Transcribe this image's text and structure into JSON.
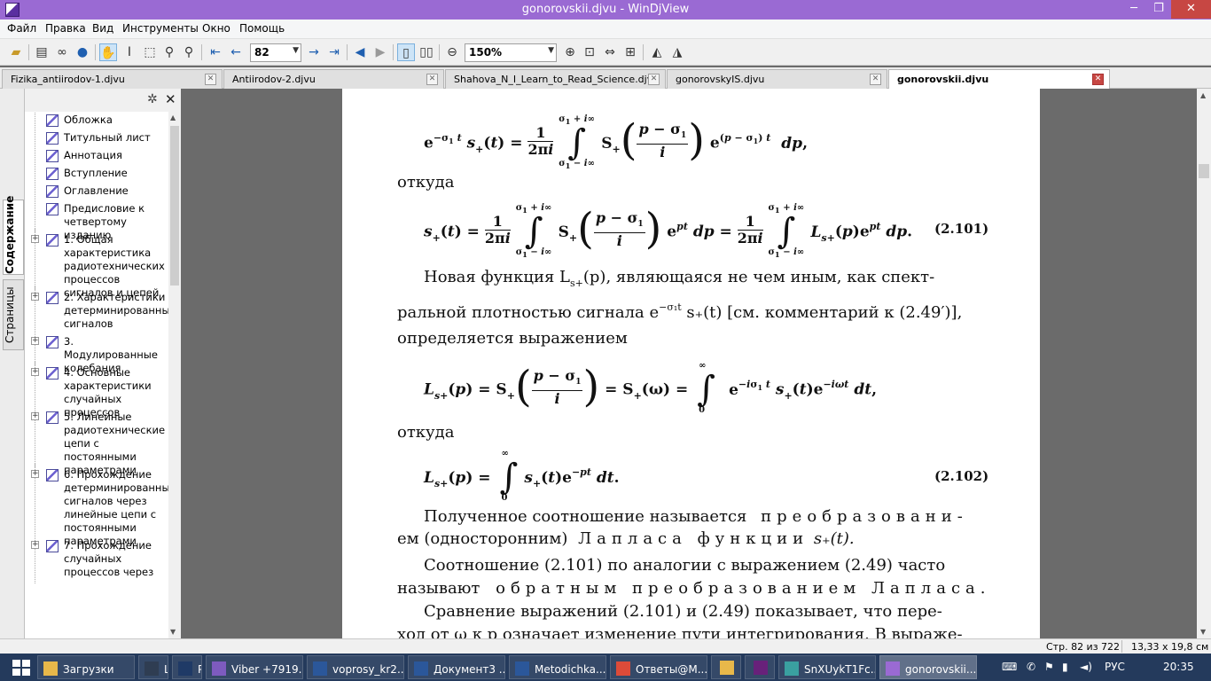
{
  "window": {
    "title": "gonorovskii.djvu - WinDjView",
    "min": "─",
    "max": "❐",
    "close": "✕"
  },
  "menu": [
    "Файл",
    "Правка",
    "Вид",
    "Инструменты",
    "Окно",
    "Помощь"
  ],
  "toolbar": {
    "page_value": "82",
    "zoom_value": "150%"
  },
  "tabs": [
    {
      "label": "Fizika_antiirodov-1.djvu"
    },
    {
      "label": "Antiirodov-2.djvu"
    },
    {
      "label": "Shahova_N_I_Learn_to_Read_Science.djvu"
    },
    {
      "label": "gonorovskyIS.djvu"
    },
    {
      "label": "gonorovskii.djvu"
    }
  ],
  "sidebar": {
    "tab_contents": "Содержание",
    "tab_pages": "Страницы",
    "close": "✕",
    "gear": "✲"
  },
  "toc": [
    {
      "label": "Обложка",
      "expandable": false
    },
    {
      "label": "Титульный лист",
      "expandable": false
    },
    {
      "label": "Аннотация",
      "expandable": false
    },
    {
      "label": "Вступление",
      "expandable": false
    },
    {
      "label": "Оглавление",
      "expandable": false
    },
    {
      "label": "Предисловие к четвертому изданию",
      "expandable": false
    },
    {
      "label": "1. Общая характеристика радиотехнических процессов сигналов и цепей",
      "expandable": true
    },
    {
      "label": "2. Характеристики детерминированных сигналов",
      "expandable": true
    },
    {
      "label": "3. Модулированные колебания",
      "expandable": true
    },
    {
      "label": "4. Основные характеристики случайных процессов",
      "expandable": true
    },
    {
      "label": "5. Линейные радиотехнические цепи с постоянными параметрами",
      "expandable": true
    },
    {
      "label": "6. Прохождение детерминированных сигналов через линейные цепи с постоянными параметрами",
      "expandable": true
    },
    {
      "label": "7. Прохождение случайных процессов через",
      "expandable": true
    }
  ],
  "document": {
    "word_otkuda_1": "откуда",
    "word_otkuda_2": "откуда",
    "eq_101_num": "(2.101)",
    "eq_102_num": "(2.102)",
    "p1_l1": "Новая функция L",
    "p1_l1_sub": "s+",
    "p1_l1_rest": "(p), являющаяся не чем иным, как спект-",
    "p1_l2a": "ральной плотностью сигнала e",
    "p1_l2_sup": "−σ₁t",
    "p1_l2b": "s₊(t) [см. комментарий к (2.49′)],",
    "p1_l3": "определяется выражением",
    "p2_l1a": "Полученное соотношение называется",
    "p2_l1b": "преобразовани-",
    "p2_l2a": "ем (односторонним)",
    "p2_l2b": "Лапласа функции",
    "p2_l2c": "s₊(t).",
    "p3_l1": "Соотношение (2.101) по аналогии с выражением (2.49) часто",
    "p3_l2a": "называют",
    "p3_l2b": "обратным преобразованием Лапласа.",
    "p4_l1": "Сравнение выражений (2.101) и (2.49) показывает, что пере-",
    "p4_l2": "ход от ω к p означает изменение пути интегрирования. В выраже-"
  },
  "status": {
    "page_info": "Стр. 82 из 722",
    "size_info": "13,33 x 19,8 см"
  },
  "taskbar": {
    "items": [
      {
        "label": "Загрузки",
        "color": "#e8b84a"
      },
      {
        "label": "Lr",
        "color": "#2f3d52"
      },
      {
        "label": "Ps",
        "color": "#1f3a66"
      },
      {
        "label": "Viber +7919...",
        "color": "#7d5bbf"
      },
      {
        "label": "voprosy_kr2....",
        "color": "#2b579a"
      },
      {
        "label": "Документ3 ...",
        "color": "#2b579a"
      },
      {
        "label": "Metodichka....",
        "color": "#2b579a"
      },
      {
        "label": "Ответы@M...",
        "color": "#dd4b39"
      },
      {
        "label": "",
        "color": "#e8b84a"
      },
      {
        "label": "",
        "color": "#68217a"
      },
      {
        "label": "SnXUykT1Fc...",
        "color": "#3aa0a0"
      },
      {
        "label": "gonorovskii....",
        "color": "#9a6ad3"
      }
    ],
    "lang": "РУС",
    "time": "20:35"
  }
}
